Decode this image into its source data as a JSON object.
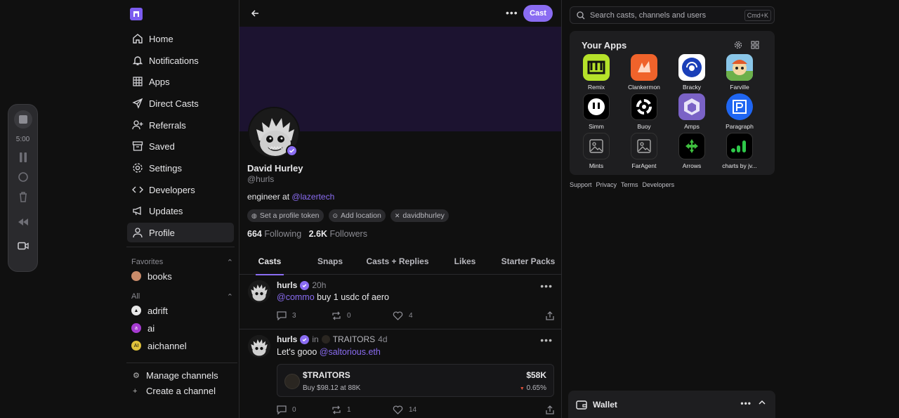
{
  "recorder": {
    "time": "5:00"
  },
  "sidebar": {
    "nav": [
      {
        "label": "Home",
        "icon": "home-icon"
      },
      {
        "label": "Notifications",
        "icon": "bell-icon"
      },
      {
        "label": "Apps",
        "icon": "grid-icon"
      },
      {
        "label": "Direct Casts",
        "icon": "send-icon"
      },
      {
        "label": "Referrals",
        "icon": "user-plus-icon"
      },
      {
        "label": "Saved",
        "icon": "archive-icon"
      },
      {
        "label": "Settings",
        "icon": "gear-icon"
      },
      {
        "label": "Developers",
        "icon": "code-icon"
      },
      {
        "label": "Updates",
        "icon": "megaphone-icon"
      },
      {
        "label": "Profile",
        "icon": "user-icon",
        "active": true
      }
    ],
    "favorites_label": "Favorites",
    "favorites": [
      {
        "label": "books"
      }
    ],
    "all_label": "All",
    "channels": [
      {
        "label": "adrift"
      },
      {
        "label": "ai"
      },
      {
        "label": "aichannel"
      }
    ],
    "manage_channels": "Manage channels",
    "create_channel": "Create a channel"
  },
  "header": {
    "cast_button": "Cast"
  },
  "profile": {
    "name": "David Hurley",
    "handle": "@hurls",
    "bio_prefix": "engineer at",
    "bio_link": "@lazertech",
    "chips": [
      "Set a profile token",
      "Add location",
      "davidbhurley"
    ],
    "following_count": "664",
    "following_label": "Following",
    "followers_count": "2.6K",
    "followers_label": "Followers"
  },
  "tabs": [
    "Casts",
    "Snaps",
    "Casts + Replies",
    "Likes",
    "Starter Packs"
  ],
  "casts": [
    {
      "author": "hurls",
      "time": "20h",
      "mention": "@commo",
      "text": "buy 1 usdc of aero",
      "replies": "3",
      "recasts": "0",
      "likes": "4"
    },
    {
      "author": "hurls",
      "in_label": "in",
      "channel": "TRAITORS",
      "time": "4d",
      "text": "Let's gooo",
      "mention": "@saltorious.eth",
      "token": {
        "name": "$TRAITORS",
        "sub": "Buy $98.12 at 88K",
        "price": "$58K",
        "change": "0.65%"
      },
      "replies": "0",
      "recasts": "1",
      "likes": "14"
    }
  ],
  "search": {
    "placeholder": "Search casts, channels and users",
    "shortcut": "Cmd+K"
  },
  "apps": {
    "title": "Your Apps",
    "items": [
      {
        "label": "Remix",
        "color": "#b6e22a"
      },
      {
        "label": "Clankermon",
        "color": "#f0632b"
      },
      {
        "label": "Bracky",
        "color": "#ffffff"
      },
      {
        "label": "Farville",
        "color": "#8ac6e8"
      },
      {
        "label": "Simm",
        "color": "#000000"
      },
      {
        "label": "Buoy",
        "color": "#000000"
      },
      {
        "label": "Amps",
        "color": "#7a62c6"
      },
      {
        "label": "Paragraph",
        "color": "#1f66f2"
      },
      {
        "label": "Mints",
        "color": "#1e1e20"
      },
      {
        "label": "FarAgent",
        "color": "#1e1e20"
      },
      {
        "label": "Arrows",
        "color": "#000000"
      },
      {
        "label": "charts by jv...",
        "color": "#000000"
      }
    ]
  },
  "footer_links": [
    "Support",
    "Privacy",
    "Terms",
    "Developers"
  ],
  "wallet": {
    "label": "Wallet"
  }
}
